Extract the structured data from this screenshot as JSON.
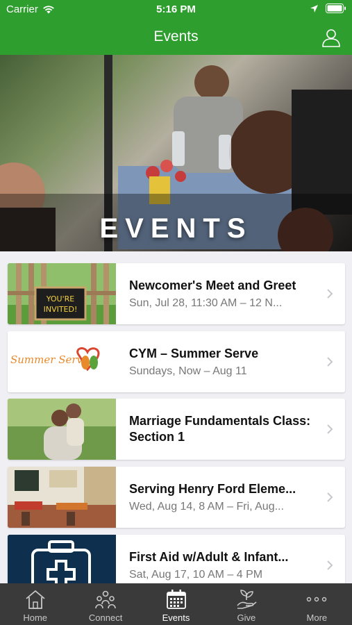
{
  "status_bar": {
    "carrier": "Carrier",
    "time": "5:16 PM"
  },
  "nav": {
    "title": "Events",
    "profile_icon": "person-icon"
  },
  "hero": {
    "text": "EVENTS"
  },
  "events": [
    {
      "title": "Newcomer's Meet and Greet",
      "date": "Sun, Jul 28, 11:30 AM – 12 N...",
      "thumb_text": "YOU'RE INVITED!"
    },
    {
      "title": "CYM – Summer Serve",
      "date": "Sundays, Now – Aug 11",
      "thumb_text": "Summer Serve"
    },
    {
      "title": "Marriage Fundamentals Class: Section 1",
      "date": ""
    },
    {
      "title": "Serving Henry Ford Eleme...",
      "date": "Wed, Aug 14, 8 AM – Fri, Aug..."
    },
    {
      "title": "First Aid w/Adult & Infant...",
      "date": "Sat, Aug 17, 10 AM – 4 PM"
    }
  ],
  "tabs": [
    {
      "label": "Home",
      "icon": "house-icon"
    },
    {
      "label": "Connect",
      "icon": "people-icon"
    },
    {
      "label": "Events",
      "icon": "calendar-icon"
    },
    {
      "label": "Give",
      "icon": "hand-plant-icon"
    },
    {
      "label": "More",
      "icon": "more-dots-icon"
    }
  ],
  "colors": {
    "brand_green": "#2e9e2e",
    "tab_bar": "#3a3a3a"
  }
}
